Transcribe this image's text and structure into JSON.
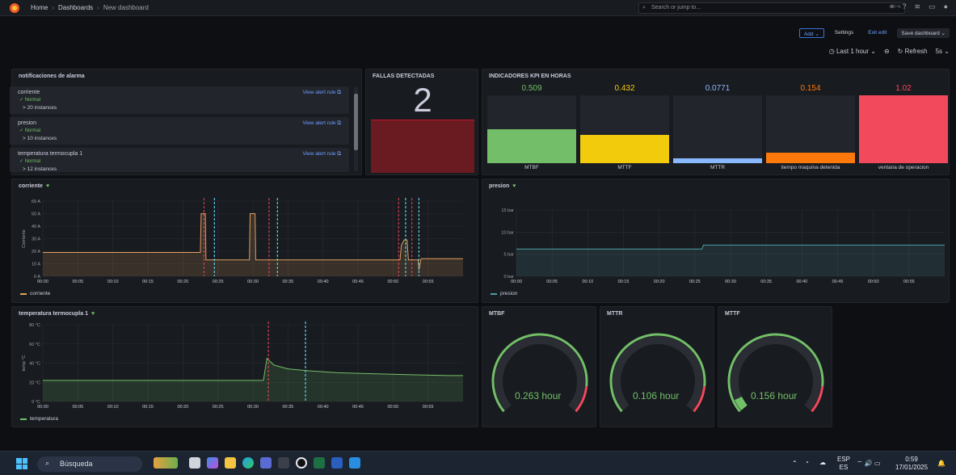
{
  "breadcrumb": {
    "home": "Home",
    "dashboards": "Dashboards",
    "current": "New dashboard"
  },
  "search": {
    "placeholder": "Search or jump to...",
    "shortcut": "ctrl+k"
  },
  "toolbar": {
    "add": "Add ⌄",
    "settings": "Settings",
    "exit_edit": "Exit edit",
    "save": "Save dashboard ⌄"
  },
  "time": {
    "range": "Last 1 hour",
    "refresh": "Refresh",
    "interval": "5s"
  },
  "alerts_panel": {
    "title": "notificaciones de alarma",
    "rows": [
      {
        "name": "corriente",
        "status": "Normal",
        "instances": "> 20 instances",
        "link": "View alert rule"
      },
      {
        "name": "presion",
        "status": "Normal",
        "instances": "> 10 instances",
        "link": "View alert rule"
      },
      {
        "name": "temperatura termocupla 1",
        "status": "Normal",
        "instances": "> 12 instances",
        "link": "View alert rule"
      }
    ]
  },
  "fallas_panel": {
    "title": "FALLAS DETECTADAS",
    "value": "2"
  },
  "kpi_panel": {
    "title": "INDICADORES KPI EN HORAS",
    "items": [
      {
        "label": "MTBF",
        "value": "0.509",
        "color": "#73bf69",
        "fill": 0.5
      },
      {
        "label": "MTTF",
        "value": "0.432",
        "color": "#f2cc0c",
        "fill": 0.42
      },
      {
        "label": "MTTR",
        "value": "0.0771",
        "color": "#8ab8ff",
        "fill": 0.075
      },
      {
        "label": "tiempo maquina detenida",
        "value": "0.154",
        "color": "#ff780a",
        "fill": 0.15
      },
      {
        "label": "ventana de operacion",
        "value": "1.02",
        "color": "#f2495c",
        "fill": 1.0
      }
    ]
  },
  "chart_data": [
    {
      "type": "line",
      "title": "corriente",
      "ylabel": "Corriente",
      "yticks": [
        "60 A",
        "50 A",
        "40 A",
        "30 A",
        "20 A",
        "10 A",
        "0 A"
      ],
      "xticks": [
        "00:00",
        "00:05",
        "00:10",
        "00:15",
        "00:20",
        "00:25",
        "00:30",
        "00:35",
        "00:40",
        "00:45",
        "00:50",
        "00:55"
      ],
      "ylim": [
        0,
        60
      ],
      "series": [
        {
          "name": "corriente",
          "color": "#e0a060",
          "points": [
            [
              0,
              19
            ],
            [
              20,
              19
            ],
            [
              22.5,
              19
            ],
            [
              22.6,
              50
            ],
            [
              23.2,
              50
            ],
            [
              23.3,
              13
            ],
            [
              29.5,
              13
            ],
            [
              29.6,
              50
            ],
            [
              30.3,
              50
            ],
            [
              30.4,
              13
            ],
            [
              51,
              13
            ],
            [
              51.2,
              25
            ],
            [
              51.6,
              29
            ],
            [
              52,
              29
            ],
            [
              52.2,
              13
            ],
            [
              53.6,
              13
            ],
            [
              53.7,
              5
            ],
            [
              54,
              14
            ],
            [
              60,
              14
            ]
          ]
        }
      ],
      "alert_lines_red": [
        23.0,
        32.3,
        50.8,
        52.7
      ],
      "alert_lines_blue": [
        24.5,
        33.5,
        51.8,
        53.7
      ]
    },
    {
      "type": "line",
      "title": "presion",
      "yticks": [
        "15 bar",
        "10 bar",
        "5 bar",
        "0 bar"
      ],
      "xticks": [
        "00:00",
        "00:05",
        "00:10",
        "00:15",
        "00:20",
        "00:25",
        "00:30",
        "00:35",
        "00:40",
        "00:45",
        "00:50",
        "00:55"
      ],
      "ylim": [
        0,
        17
      ],
      "series": [
        {
          "name": "presion",
          "color": "#4e9ea8",
          "points": [
            [
              0,
              7.0
            ],
            [
              25,
              7.0
            ],
            [
              26,
              7.0
            ],
            [
              26.2,
              8.0
            ],
            [
              60,
              8.0
            ]
          ]
        }
      ]
    },
    {
      "type": "area",
      "title": "temperatura termocupla 1",
      "ylabel": "temp °C",
      "yticks": [
        "80 °C",
        "60 °C",
        "40 °C",
        "20 °C",
        "0 °C"
      ],
      "xticks": [
        "00:00",
        "00:05",
        "00:10",
        "00:15",
        "00:20",
        "00:25",
        "00:30",
        "00:35",
        "00:40",
        "00:45",
        "00:50",
        "00:55"
      ],
      "ylim": [
        0,
        80
      ],
      "series": [
        {
          "name": "temperatura",
          "color": "#73bf69",
          "points": [
            [
              0,
              22
            ],
            [
              31.5,
              22
            ],
            [
              32,
              45
            ],
            [
              33,
              38
            ],
            [
              35,
              34
            ],
            [
              38,
              32
            ],
            [
              42,
              30
            ],
            [
              47,
              29
            ],
            [
              52,
              28
            ],
            [
              58,
              27
            ],
            [
              60,
              27
            ]
          ]
        }
      ],
      "alert_lines_red": [
        32.2
      ],
      "alert_lines_blue": [
        37.5
      ]
    }
  ],
  "gauges": [
    {
      "title": "MTBF",
      "value": "0.263 hour",
      "fraction": 0.0
    },
    {
      "title": "MTTR",
      "value": "0.106 hour",
      "fraction": 0.0
    },
    {
      "title": "MTTF",
      "value": "0.156 hour",
      "fraction": 0.06
    }
  ],
  "taskbar": {
    "search": "Búsqueda",
    "lang": "ESP",
    "lang2": "ES",
    "time": "0:59",
    "date": "17/01/2025"
  }
}
